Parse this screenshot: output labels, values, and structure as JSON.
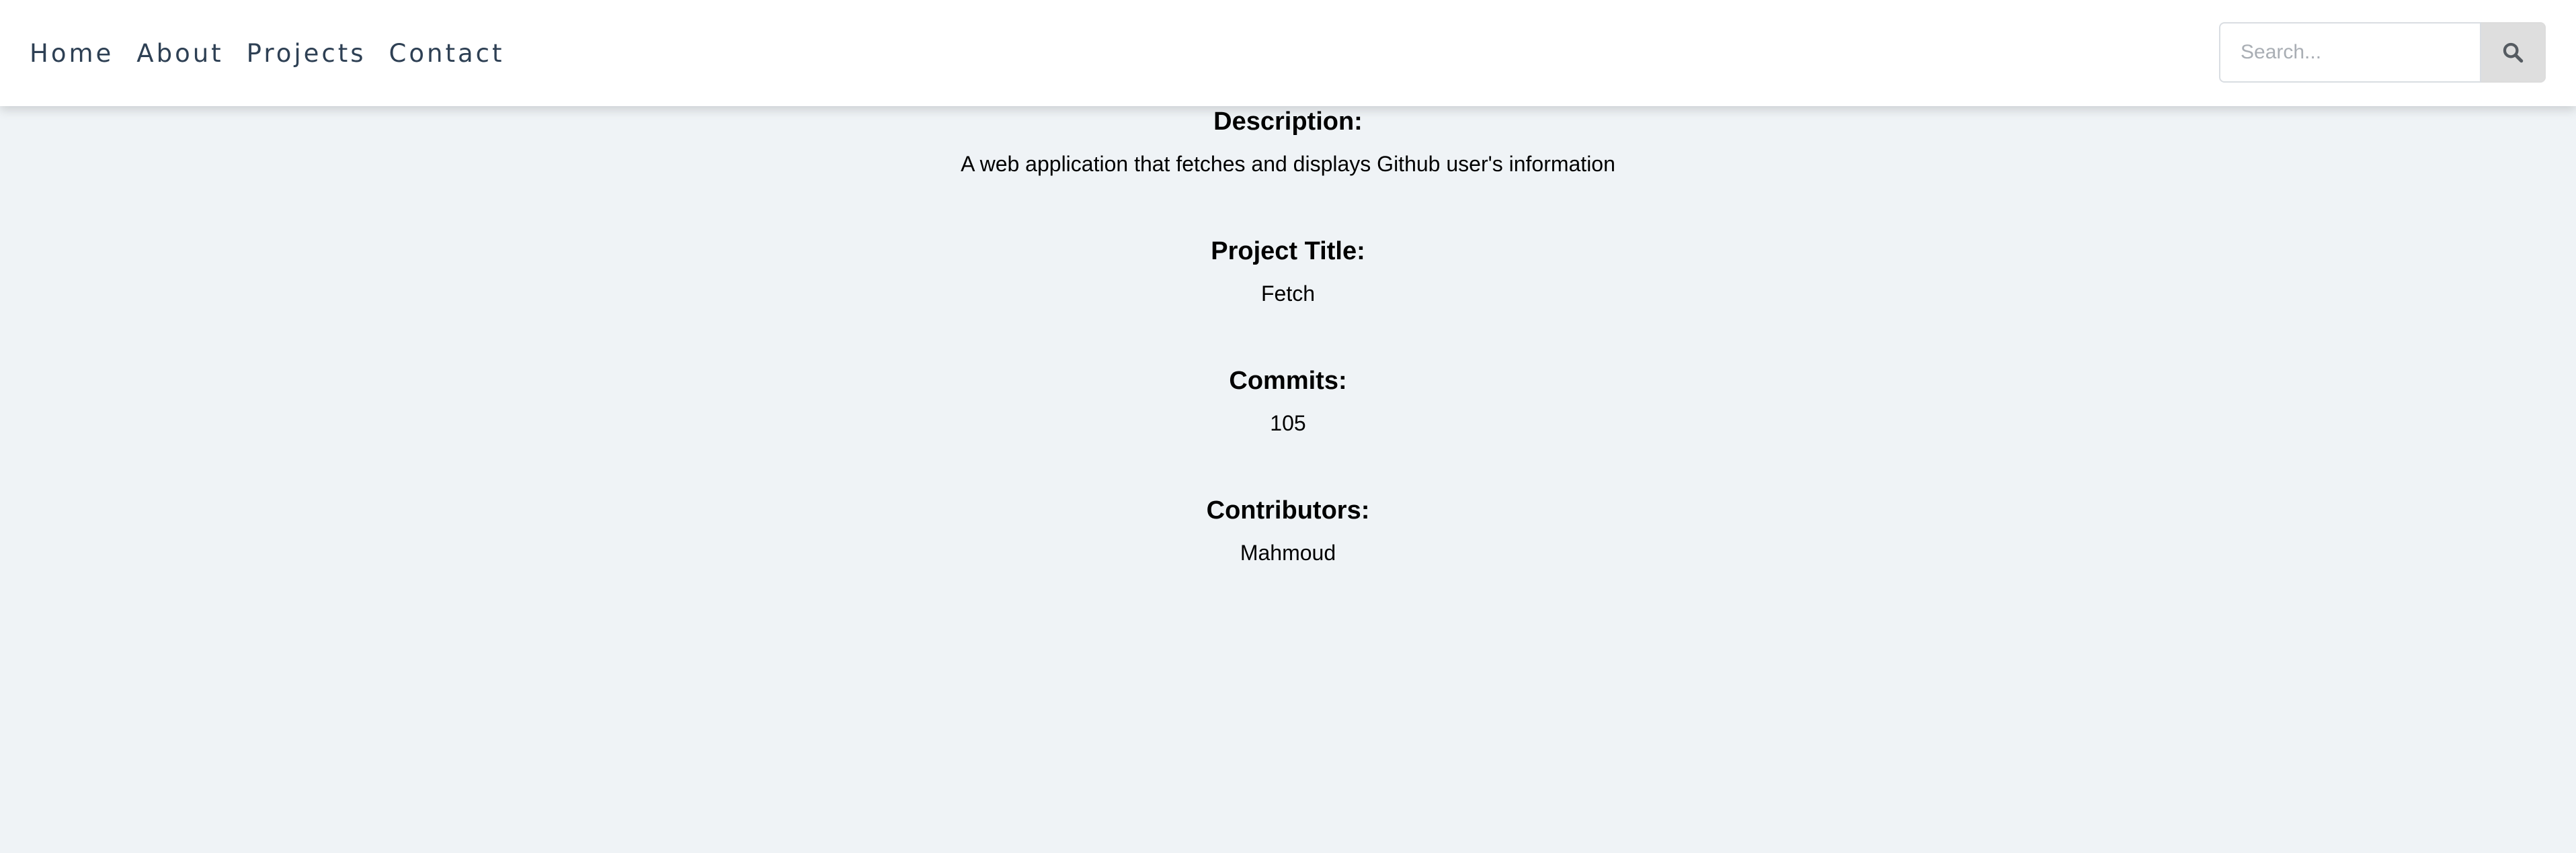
{
  "nav": {
    "links": [
      "Home",
      "About",
      "Projects",
      "Contact"
    ]
  },
  "search": {
    "placeholder": "Search...",
    "value": "",
    "button_icon": "search-icon"
  },
  "project": {
    "description_label": "Description:",
    "description": "A web application that fetches and displays Github user's information",
    "title_label": "Project Title:",
    "title": "Fetch",
    "commits_label": "Commits:",
    "commits": "105",
    "contributors_label": "Contributors:",
    "contributors": "Mahmoud"
  },
  "colors": {
    "page_background": "#eff3f6",
    "navbar_background": "#ffffff",
    "nav_text": "#2e4054",
    "search_button_background": "#dedede",
    "search_icon": "#555b61"
  }
}
